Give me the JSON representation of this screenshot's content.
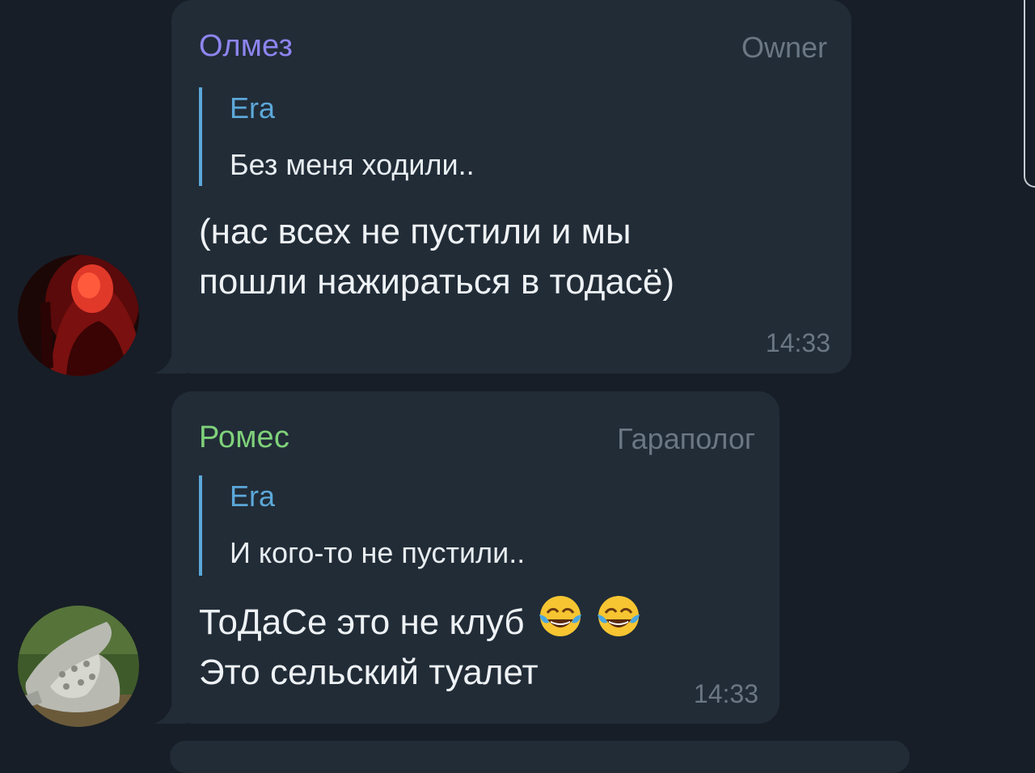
{
  "messages": [
    {
      "author": "Олмез",
      "role": "Owner",
      "author_color": "#8e85f0",
      "reply": {
        "author": "Era",
        "text": "Без меня ходили.."
      },
      "text_lines": [
        "(нас всех не пустили и мы",
        "пошли нажираться в тодасё)"
      ],
      "time": "14:33",
      "avatar": "red-hood-avatar"
    },
    {
      "author": "Ромес",
      "role": "Гараполог",
      "author_color": "#7fd17a",
      "reply": {
        "author": "Era",
        "text": "И кого-то не пустили.."
      },
      "text_lines": [
        "ТоДаСе это не клуб",
        "Это сельский туалет"
      ],
      "emoji": "face-with-tears-of-joy-icon",
      "time": "14:33",
      "avatar": "crocodile-avatar"
    }
  ]
}
